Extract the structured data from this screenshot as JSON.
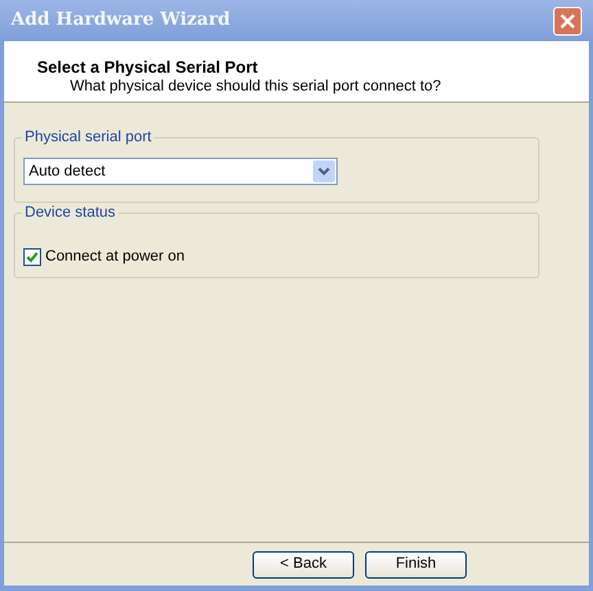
{
  "window": {
    "title": "Add Hardware Wizard"
  },
  "header": {
    "title": "Select a Physical Serial Port",
    "subtitle": "What physical device should this serial port connect to?"
  },
  "physical_serial_port": {
    "label": "Physical serial port",
    "value": "Auto detect"
  },
  "device_status": {
    "label": "Device status",
    "checkbox": {
      "label": "Connect at power on",
      "checked": true
    }
  },
  "buttons": [
    {
      "label": "< Back"
    },
    {
      "label": "Finish"
    }
  ]
}
